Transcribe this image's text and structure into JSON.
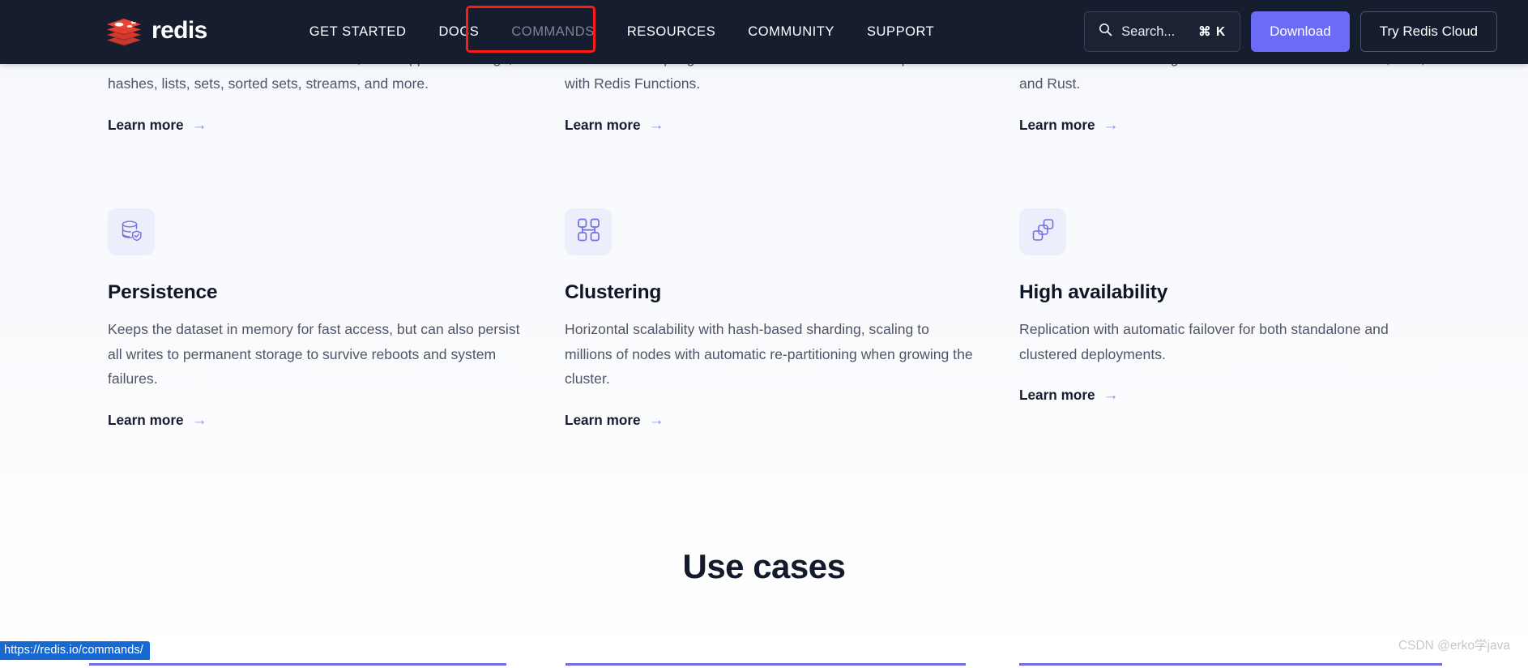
{
  "navbar": {
    "brand": {
      "name": "redis",
      "logo_icon": "redis-logo-icon"
    },
    "links": [
      {
        "label": "GET STARTED",
        "name": "nav-link-get-started",
        "dim": false
      },
      {
        "label": "DOCS",
        "name": "nav-link-docs",
        "dim": false
      },
      {
        "label": "COMMANDS",
        "name": "nav-link-commands",
        "dim": true
      },
      {
        "label": "RESOURCES",
        "name": "nav-link-resources",
        "dim": false
      },
      {
        "label": "COMMUNITY",
        "name": "nav-link-community",
        "dim": false
      },
      {
        "label": "SUPPORT",
        "name": "nav-link-support",
        "dim": false
      }
    ],
    "search": {
      "label": "Search...",
      "placeholder": "Search...",
      "shortcut": "⌘ K",
      "icon": "search-icon"
    },
    "download_label": "Download",
    "cloud_label": "Try Redis Cloud",
    "accent_color": "#6c6bf5",
    "bar_color": "#161d2f",
    "highlight_color": "#fe1b12"
  },
  "features_row_1": [
    {
      "desc": "Well-known as a \"data structure server\", with support for strings, hashes, lists, sets, sorted sets, streams, and more.",
      "learn_more": "Learn more"
    },
    {
      "desc": "Server-side scripting with Lua and server-side stored procedures with Redis Functions.",
      "learn_more": "Learn more"
    },
    {
      "desc": "A module API for building custom extensions to Redis in C, C++, and Rust.",
      "learn_more": "Learn more"
    }
  ],
  "features_row_2": [
    {
      "icon": "database-shield-icon",
      "title": "Persistence",
      "desc": "Keeps the dataset in memory for fast access, but can also persist all writes to permanent storage to survive reboots and system failures.",
      "learn_more": "Learn more"
    },
    {
      "icon": "cluster-nodes-icon",
      "title": "Clustering",
      "desc": "Horizontal scalability with hash-based sharding, scaling to millions of nodes with automatic re-partitioning when growing the cluster.",
      "learn_more": "Learn more"
    },
    {
      "icon": "stacked-squares-icon",
      "title": "High availability",
      "desc": "Replication with automatic failover for both standalone and clustered deployments.",
      "learn_more": "Learn more"
    }
  ],
  "use_cases": {
    "heading": "Use cases",
    "rule_color": "#6f70e0"
  },
  "status": {
    "link_preview": "https://redis.io/commands/",
    "link_preview_bg": "#1569d1"
  },
  "watermark": "CSDN @erko学java",
  "arrow_glyph": "→"
}
